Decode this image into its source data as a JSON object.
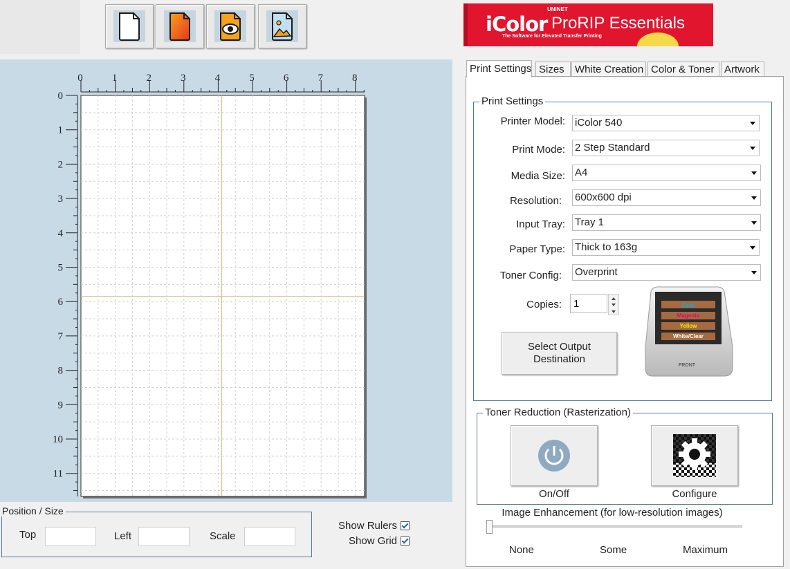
{
  "toolbar": {
    "buttons": [
      {
        "name": "new-document",
        "icon": "blank-page-icon"
      },
      {
        "name": "color-document",
        "icon": "color-page-icon"
      },
      {
        "name": "preview",
        "icon": "eye-page-icon"
      },
      {
        "name": "image",
        "icon": "image-page-icon"
      }
    ]
  },
  "logo": {
    "brand": "iColor",
    "uninet": "UNINET",
    "product": "ProRIP Essentials",
    "tagline": "The Software for Elevated Transfer Printing"
  },
  "ruler": {
    "x_labels": [
      "0",
      "1",
      "2",
      "3",
      "4",
      "5",
      "6",
      "7",
      "8"
    ],
    "y_labels": [
      "0",
      "1",
      "2",
      "3",
      "4",
      "5",
      "6",
      "7",
      "8",
      "9",
      "10",
      "11"
    ]
  },
  "position_size": {
    "title": "Position / Size",
    "top_label": "Top",
    "left_label": "Left",
    "scale_label": "Scale",
    "top_value": "",
    "left_value": "",
    "scale_value": ""
  },
  "view_options": {
    "show_rulers_label": "Show Rulers",
    "show_rulers_checked": true,
    "show_grid_label": "Show Grid",
    "show_grid_checked": true
  },
  "tabs": [
    {
      "label": "Print Settings",
      "active": true
    },
    {
      "label": "Sizes",
      "active": false
    },
    {
      "label": "White Creation",
      "active": false
    },
    {
      "label": "Color & Toner",
      "active": false
    },
    {
      "label": "Artwork",
      "active": false
    }
  ],
  "print_settings": {
    "group_title": "Print Settings",
    "fields": [
      {
        "label": "Printer Model:",
        "value": "iColor 540"
      },
      {
        "label": "Print Mode:",
        "value": "2 Step Standard"
      },
      {
        "label": "Media Size:",
        "value": "A4"
      },
      {
        "label": "Resolution:",
        "value": "600x600 dpi"
      },
      {
        "label": "Input Tray:",
        "value": "Tray 1"
      },
      {
        "label": "Paper Type:",
        "value": "Thick to 163g"
      },
      {
        "label": "Toner Config:",
        "value": "Overprint"
      }
    ],
    "copies_label": "Copies:",
    "copies_value": "1",
    "output_button": "Select Output Destination",
    "printer_image": {
      "slots": [
        "Cyan",
        "Magenta",
        "Yellow",
        "White/Clear"
      ],
      "slot_colors": [
        "#00aeef",
        "#e6007e",
        "#f5e800",
        "#ffffff"
      ],
      "front_label": "FRONT"
    }
  },
  "toner_reduction": {
    "group_title": "Toner Reduction (Rasterization)",
    "onoff_label": "On/Off",
    "configure_label": "Configure"
  },
  "image_enhancement": {
    "title": "Image Enhancement (for low-resolution images)",
    "ticks": [
      "None",
      "Some",
      "Maximum"
    ],
    "value": 0
  }
}
